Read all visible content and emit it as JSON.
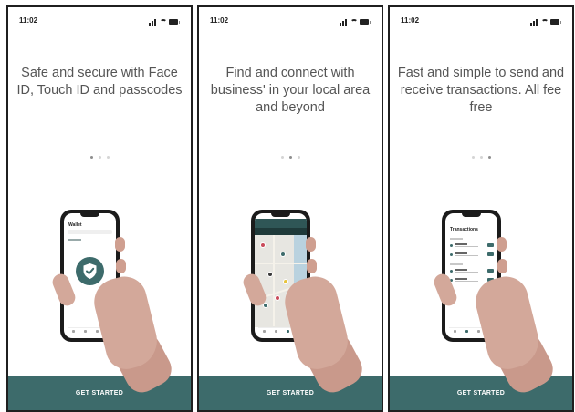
{
  "screens": [
    {
      "status_time": "11:02",
      "headline": "Safe and secure with Face ID, Touch ID and passcodes",
      "active_dot": 0,
      "phone_content": {
        "title": "Wallet",
        "icon": "shield-check-icon"
      },
      "cta_label": "GET STARTED"
    },
    {
      "status_time": "11:02",
      "headline": "Find and connect with business' in your local area and beyond",
      "active_dot": 1,
      "phone_content": {
        "icon": "map-icon"
      },
      "cta_label": "GET STARTED"
    },
    {
      "status_time": "11:02",
      "headline": "Fast and simple to send and receive transactions. All fee free",
      "active_dot": 2,
      "phone_content": {
        "title": "Transactions",
        "icon": "transactions-list-icon"
      },
      "cta_label": "GET STARTED"
    }
  ],
  "colors": {
    "accent": "#3d6b6b",
    "headline_text": "#555555",
    "dot_active": "#8e8e8e",
    "dot_inactive": "#d5d5d5",
    "skin": "#d3a89a"
  }
}
